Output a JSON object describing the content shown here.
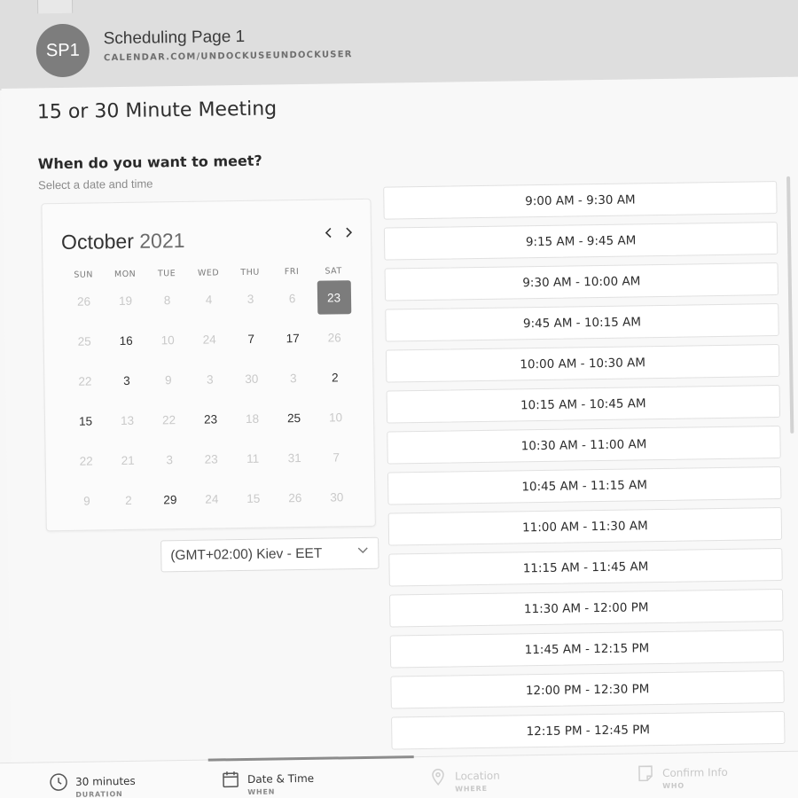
{
  "header": {
    "avatar_initials": "SP1",
    "page_name": "Scheduling Page 1",
    "page_url": "CALENDAR.COM/UNDOCKUSEUNDOCKUSER"
  },
  "meeting_title": "15 or 30 Minute Meeting",
  "prompt": {
    "question": "When do you want to meet?",
    "hint": "Select a date and time"
  },
  "calendar": {
    "month": "October",
    "year": "2021",
    "prev_icon": "chevron-left-icon",
    "next_icon": "chevron-right-icon",
    "weekdays": [
      "SUN",
      "MON",
      "TUE",
      "WED",
      "THU",
      "FRI",
      "SAT"
    ],
    "selected": "23",
    "weeks": [
      [
        {
          "d": "26",
          "on": false
        },
        {
          "d": "19",
          "on": false
        },
        {
          "d": "8",
          "on": false
        },
        {
          "d": "4",
          "on": false
        },
        {
          "d": "3",
          "on": false
        },
        {
          "d": "6",
          "on": false
        },
        {
          "d": "23",
          "on": true,
          "sel": true
        }
      ],
      [
        {
          "d": "25",
          "on": false
        },
        {
          "d": "16",
          "on": true
        },
        {
          "d": "10",
          "on": false
        },
        {
          "d": "24",
          "on": false
        },
        {
          "d": "7",
          "on": true
        },
        {
          "d": "17",
          "on": true
        },
        {
          "d": "26",
          "on": false
        }
      ],
      [
        {
          "d": "22",
          "on": false
        },
        {
          "d": "3",
          "on": true
        },
        {
          "d": "9",
          "on": false
        },
        {
          "d": "3",
          "on": false
        },
        {
          "d": "30",
          "on": false
        },
        {
          "d": "3",
          "on": false
        },
        {
          "d": "2",
          "on": true
        }
      ],
      [
        {
          "d": "15",
          "on": true
        },
        {
          "d": "13",
          "on": false
        },
        {
          "d": "22",
          "on": false
        },
        {
          "d": "23",
          "on": true
        },
        {
          "d": "18",
          "on": false
        },
        {
          "d": "25",
          "on": true
        },
        {
          "d": "10",
          "on": false
        }
      ],
      [
        {
          "d": "22",
          "on": false
        },
        {
          "d": "21",
          "on": false
        },
        {
          "d": "3",
          "on": false
        },
        {
          "d": "23",
          "on": false
        },
        {
          "d": "11",
          "on": false
        },
        {
          "d": "31",
          "on": false
        },
        {
          "d": "7",
          "on": false
        }
      ],
      [
        {
          "d": "9",
          "on": false
        },
        {
          "d": "2",
          "on": false
        },
        {
          "d": "29",
          "on": true
        },
        {
          "d": "24",
          "on": false
        },
        {
          "d": "15",
          "on": false
        },
        {
          "d": "26",
          "on": false
        },
        {
          "d": "30",
          "on": false
        }
      ]
    ]
  },
  "timezone": {
    "value": "(GMT+02:00) Kiev - EET",
    "icon": "chevron-down-icon"
  },
  "time_slots": [
    "9:00 AM - 9:30 AM",
    "9:15 AM - 9:45 AM",
    "9:30 AM - 10:00 AM",
    "9:45 AM - 10:15 AM",
    "10:00 AM - 10:30 AM",
    "10:15 AM - 10:45 AM",
    "10:30 AM - 11:00 AM",
    "10:45 AM - 11:15 AM",
    "11:00 AM - 11:30 AM",
    "11:15 AM - 11:45 AM",
    "11:30 AM - 12:00 PM",
    "11:45 AM - 12:15 PM",
    "12:00 PM - 12:30 PM",
    "12:15 PM - 12:45 PM"
  ],
  "steps": [
    {
      "label": "30 minutes",
      "sub": "DURATION",
      "icon": "clock-icon",
      "active": true
    },
    {
      "label": "Date & Time",
      "sub": "WHEN",
      "icon": "calendar-icon",
      "active": true
    },
    {
      "label": "Location",
      "sub": "WHERE",
      "icon": "location-pin-icon",
      "active": false
    },
    {
      "label": "Confirm Info",
      "sub": "WHO",
      "icon": "note-icon",
      "active": false
    }
  ],
  "colors": {
    "accent": "#7c7c7c",
    "header_bg": "#dedede",
    "page_bg": "#f8f8f8"
  }
}
